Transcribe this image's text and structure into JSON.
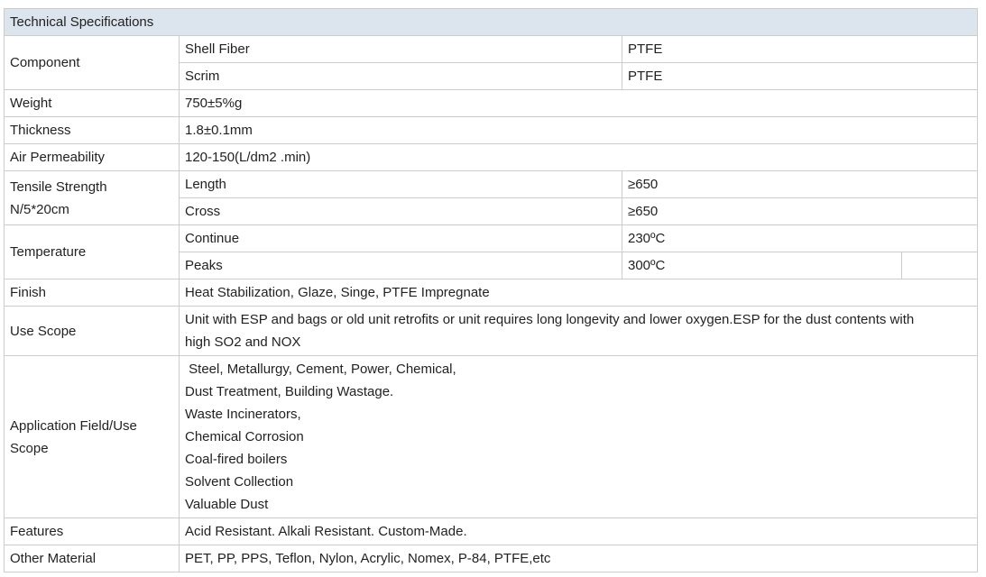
{
  "table": {
    "title": "Technical Specifications",
    "component_label": "Component",
    "shell_fiber_label": "Shell Fiber",
    "shell_fiber_value": "PTFE",
    "scrim_label": "Scrim",
    "scrim_value": "PTFE",
    "weight_label": "Weight",
    "weight_value": "750±5%g",
    "thickness_label": "Thickness",
    "thickness_value": "1.8±0.1mm",
    "air_perm_label": "Air Permeability",
    "air_perm_value": "120-150(L/dm2 .min)",
    "tensile_label_1": "Tensile Strength",
    "tensile_label_2": "N/5*20cm",
    "length_label": "Length",
    "length_value": "≥650",
    "cross_label": "Cross",
    "cross_value": "≥650",
    "temperature_label": "Temperature",
    "continue_label": "Continue",
    "continue_value": "230ºC",
    "peaks_label": "Peaks",
    "peaks_value": "300ºC",
    "finish_label": "Finish",
    "finish_value": "Heat Stabilization, Glaze, Singe, PTFE Impregnate",
    "use_scope_label": "Use Scope",
    "use_scope_line1": "Unit with ESP and bags or old unit retrofits or unit requires long longevity and lower oxygen.ESP for the dust contents with",
    "use_scope_line2": "high SO2 and NOX",
    "app_field_label_1": "Application Field/Use",
    "app_field_label_2": "Scope",
    "app_field_lines": [
      " Steel, Metallurgy, Cement, Power, Chemical,",
      "Dust Treatment, Building Wastage.",
      "Waste Incinerators,",
      "Chemical Corrosion",
      "Coal-fired boilers",
      "Solvent Collection",
      "Valuable Dust"
    ],
    "features_label": "Features",
    "features_value": "Acid Resistant. Alkali Resistant. Custom-Made.",
    "other_material_label": "Other Material",
    "other_material_value": "PET, PP, PPS, Teflon, Nylon, Acrylic, Nomex, P-84, PTFE,etc"
  }
}
